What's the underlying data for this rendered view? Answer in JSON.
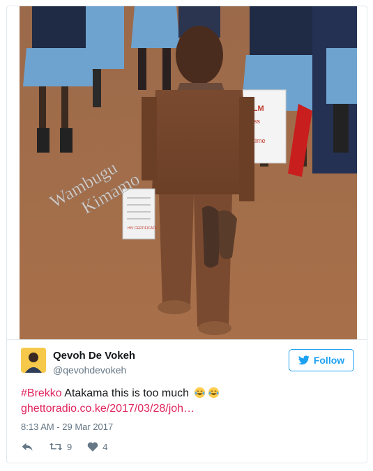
{
  "tweet": {
    "media": {
      "watermark_line1": "Wambugu",
      "watermark_line2": "Kimamo",
      "bag_text": [
        "FILM",
        "ress",
        "st",
        "fletime"
      ],
      "certificate_text": "HIV CERTIFICATE"
    },
    "author": {
      "name": "Qevoh De Vokeh",
      "handle": "@qevohdevokeh"
    },
    "follow_label": "Follow",
    "body": {
      "hashtag": "#Brekko",
      "text": " Atakama this is too much",
      "emojis": [
        "face-with-tears-of-joy",
        "face-with-tears-of-joy"
      ],
      "link": "ghettoradio.co.ke/2017/03/28/joh…"
    },
    "timestamp": "8:13 AM - 29 Mar 2017",
    "actions": {
      "retweets": "9",
      "likes": "4"
    },
    "colors": {
      "accent": "#1da1f2",
      "hashtag": "#e0245e",
      "muted": "#657786",
      "text": "#14171a"
    }
  }
}
